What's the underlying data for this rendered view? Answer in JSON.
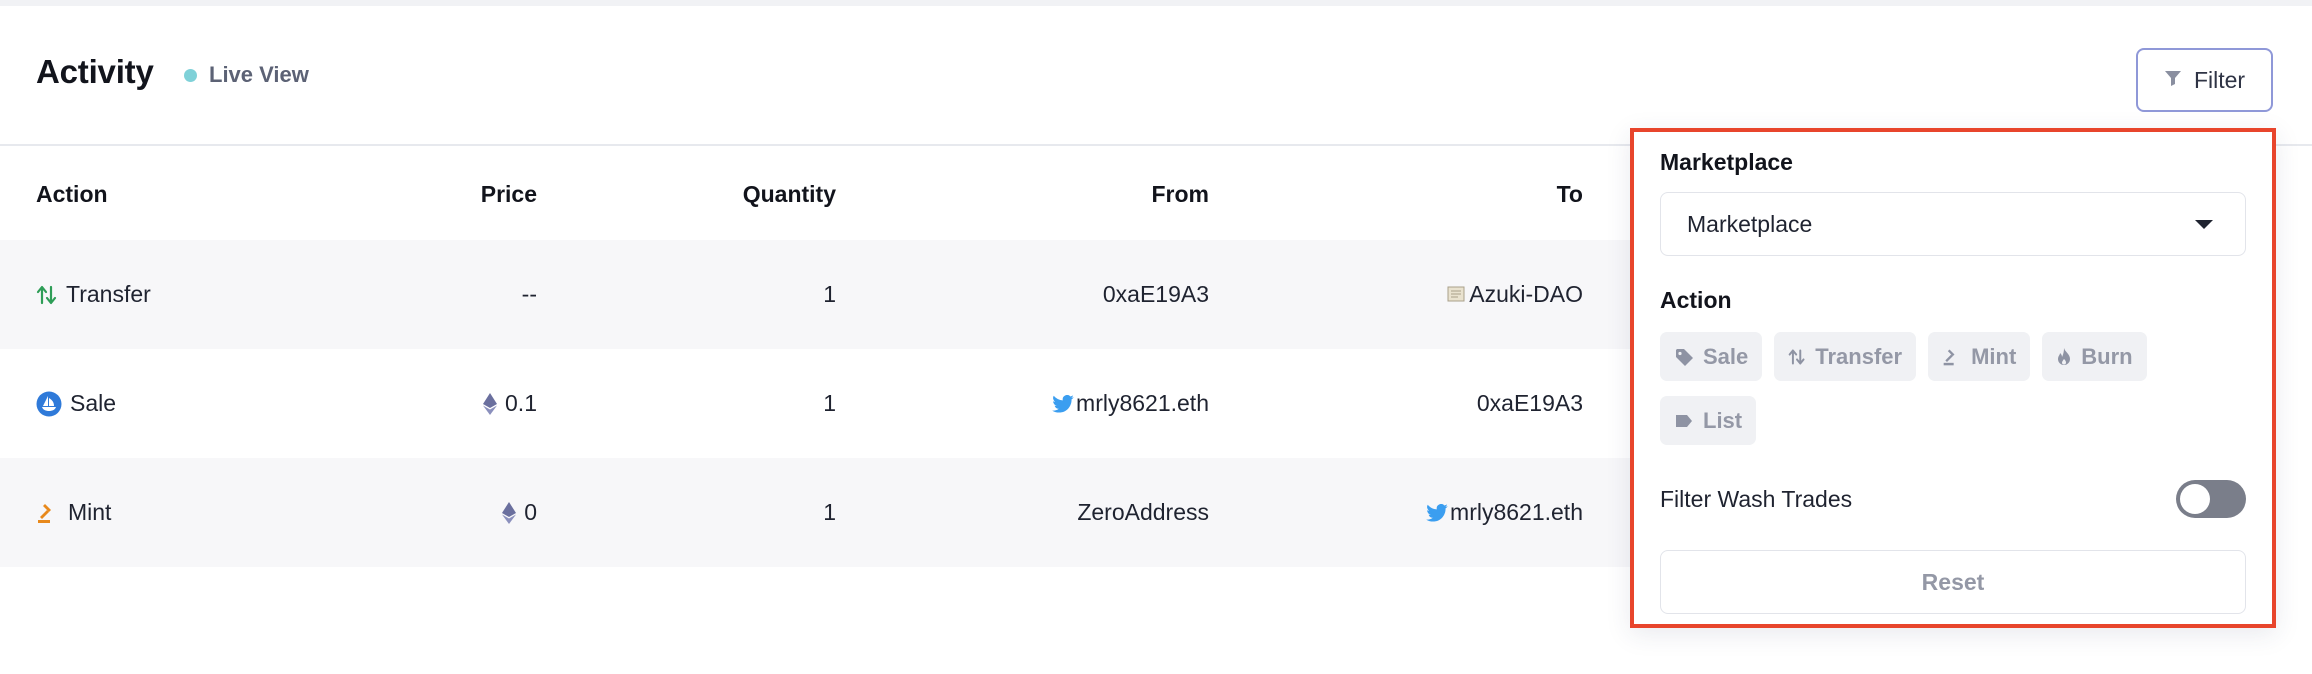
{
  "header": {
    "title": "Activity",
    "live_view_label": "Live View",
    "filter_label": "Filter"
  },
  "table": {
    "columns": {
      "action": "Action",
      "price": "Price",
      "quantity": "Quantity",
      "from": "From",
      "to": "To"
    },
    "rows": [
      {
        "action": "Transfer",
        "action_icon": "transfer-arrows-icon",
        "price": "--",
        "price_icon": "",
        "quantity": "1",
        "from": "0xaE19A3",
        "from_icon": "",
        "to": "Azuki-DAO",
        "to_icon": "scroll-icon"
      },
      {
        "action": "Sale",
        "action_icon": "opensea-icon",
        "price": "0.1",
        "price_icon": "ethereum-icon",
        "quantity": "1",
        "from": "mrly8621.eth",
        "from_icon": "twitter-icon",
        "to": "0xaE19A3",
        "to_icon": ""
      },
      {
        "action": "Mint",
        "action_icon": "gavel-icon",
        "price": "0",
        "price_icon": "ethereum-icon",
        "quantity": "1",
        "from": "ZeroAddress",
        "from_icon": "",
        "to": "mrly8621.eth",
        "to_icon": "twitter-icon"
      }
    ]
  },
  "filter_panel": {
    "marketplace_heading": "Marketplace",
    "marketplace_select_value": "Marketplace",
    "action_heading": "Action",
    "action_chips": [
      {
        "label": "Sale",
        "icon": "tag-icon"
      },
      {
        "label": "Transfer",
        "icon": "transfer-arrows-icon"
      },
      {
        "label": "Mint",
        "icon": "gavel-icon"
      },
      {
        "label": "Burn",
        "icon": "flame-icon"
      },
      {
        "label": "List",
        "icon": "label-icon"
      }
    ],
    "wash_trades_label": "Filter Wash Trades",
    "wash_trades_enabled": false,
    "reset_label": "Reset"
  },
  "colors": {
    "accent_border": "#e8452c",
    "live_dot": "#7fd1d8",
    "filter_button_border": "#8f98d8",
    "transfer_icon": "#2e9d57",
    "mint_icon": "#e8891c",
    "twitter_icon": "#3b9ef0",
    "opensea_icon": "#2f7ad9"
  }
}
